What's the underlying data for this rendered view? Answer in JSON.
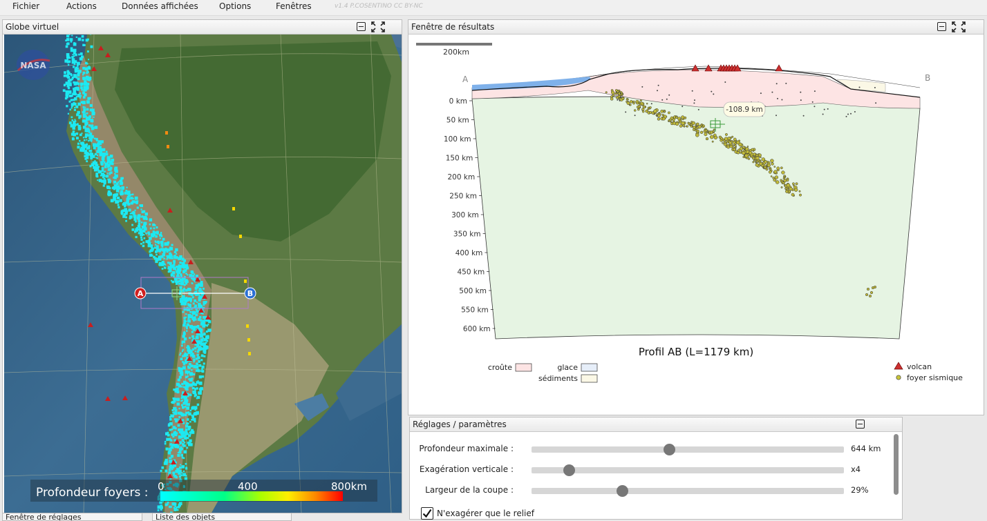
{
  "menu": {
    "items": [
      "Fichier",
      "Actions",
      "Données affichées",
      "Options",
      "Fenêtres"
    ],
    "version": "v1.4 P.COSENTINO CC BY-NC"
  },
  "globe": {
    "title": "Globe virtuel",
    "logo": "NASA",
    "point_a": "A",
    "point_b": "B",
    "legend_title": "Profondeur foyers :",
    "legend_ticks": [
      "0",
      "400",
      "800km"
    ]
  },
  "bottom_tabs": [
    "Fenêtre de réglages",
    "Liste des objets"
  ],
  "results": {
    "title": "Fenêtre de résultats",
    "scale_label": "200km",
    "label_a": "A",
    "label_b": "B",
    "depth_ticks": [
      "0 km",
      "50 km",
      "100 km",
      "150 km",
      "200 km",
      "250 km",
      "300 km",
      "350 km",
      "400 km",
      "450 km",
      "500 km",
      "550 km",
      "600 km"
    ],
    "cursor_label": "-108.9 km",
    "profile_title": "Profil AB (L=1179 km)",
    "legend": {
      "crust": "croûte",
      "ice": "glace",
      "sediments": "sédiments",
      "volcano": "volcan",
      "quake": "foyer sismique"
    },
    "colors": {
      "crust": "#fde4e4",
      "mantle": "#e6f4e3",
      "ice": "#7fb1ea",
      "sediments": "#fbf8e6",
      "volcano": "#cc3030",
      "quake": "#c8c43a"
    }
  },
  "settings": {
    "title": "Réglages / paramètres",
    "sliders": [
      {
        "label": "Profondeur maximale :",
        "value": "644 km",
        "fraction": 0.44
      },
      {
        "label": "Exagération verticale :",
        "value": "x4",
        "fraction": 0.12
      },
      {
        "label": "Largeur de la coupe :",
        "value": "29%",
        "fraction": 0.29
      }
    ],
    "checkbox_label": "N'exagérer que le relief",
    "checkbox_checked": true
  }
}
